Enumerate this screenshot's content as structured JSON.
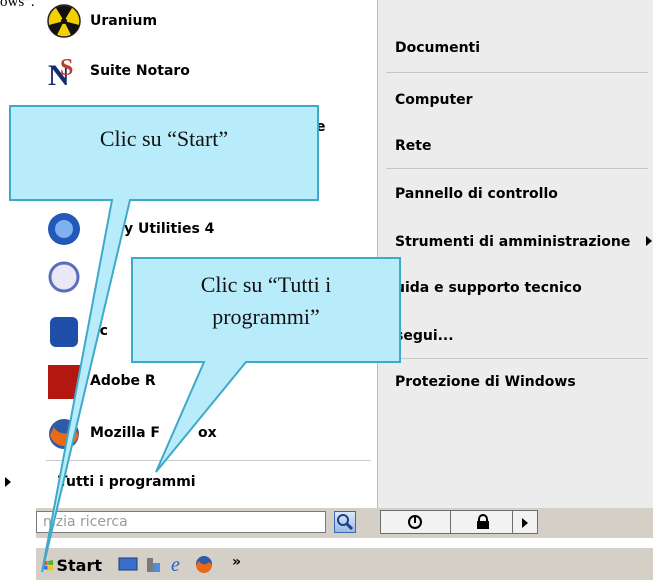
{
  "caption_fragment": "ows”.",
  "programs": [
    {
      "label": "Uranium",
      "icon": "radiation-icon"
    },
    {
      "label": "Suite Notaro",
      "icon": "notaro-logo-icon"
    },
    {
      "label": "e",
      "icon": "app-icon"
    },
    {
      "label": "y Utilities 4",
      "icon": "utilities-icon"
    },
    {
      "label": "",
      "icon": "app-icon"
    },
    {
      "label": "lic",
      "icon": "app-icon"
    },
    {
      "label": "Adobe R",
      "icon": "adobe-icon"
    },
    {
      "label": "Mozilla F",
      "label2": "ox",
      "icon": "firefox-icon"
    }
  ],
  "all_programs": "Tutti i programmi",
  "right_items": [
    "Documenti",
    "Computer",
    "Rete",
    "Pannello di controllo",
    "Strumenti di amministrazione",
    "uida e supporto tecnico",
    "segui...",
    "Protezione di Windows"
  ],
  "right_top_partial": "",
  "search": {
    "placeholder": "nizia ricerca"
  },
  "taskbar": {
    "start_label": "Start",
    "overflow": "»"
  },
  "callouts": {
    "start": "Clic su “Start”",
    "all_programs_line1": "Clic su “Tutti i",
    "all_programs_line2": "programmi”"
  },
  "colors": {
    "bubble_fill": "#b9ecfb",
    "bubble_stroke": "#3fa9c9",
    "menu_right_bg": "#ececec"
  }
}
